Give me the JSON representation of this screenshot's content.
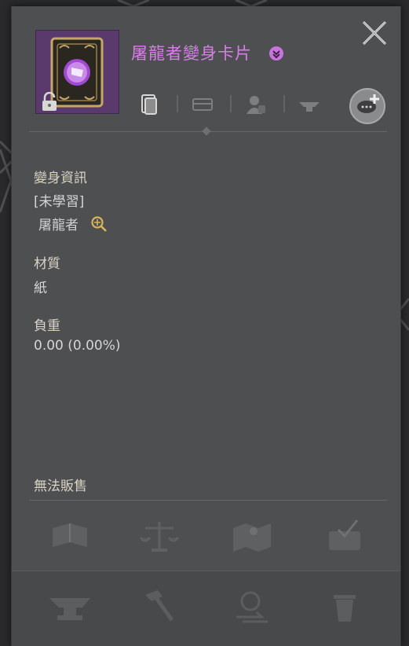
{
  "item": {
    "name": "屠龍者變身卡片",
    "name_color": "#d77ee8"
  },
  "info": {
    "transform_label": "變身資訊",
    "status": "[未學習]",
    "creature": "屠龍者",
    "material_label": "材質",
    "material_value": "紙",
    "weight_label": "負重",
    "weight_value": "0.00 (0.00%)",
    "sell_note": "無法販售"
  },
  "icons": {
    "tabs": [
      "card-tab-icon",
      "equipment-tab-icon",
      "character-tab-icon",
      "anvil-tab-icon"
    ],
    "share": "chat-share-icon",
    "row1": [
      "book-icon",
      "scale-icon",
      "map-icon",
      "basket-icon"
    ],
    "row2": [
      "anvil-icon",
      "hammer-icon",
      "search-swap-icon",
      "trash-icon"
    ]
  }
}
